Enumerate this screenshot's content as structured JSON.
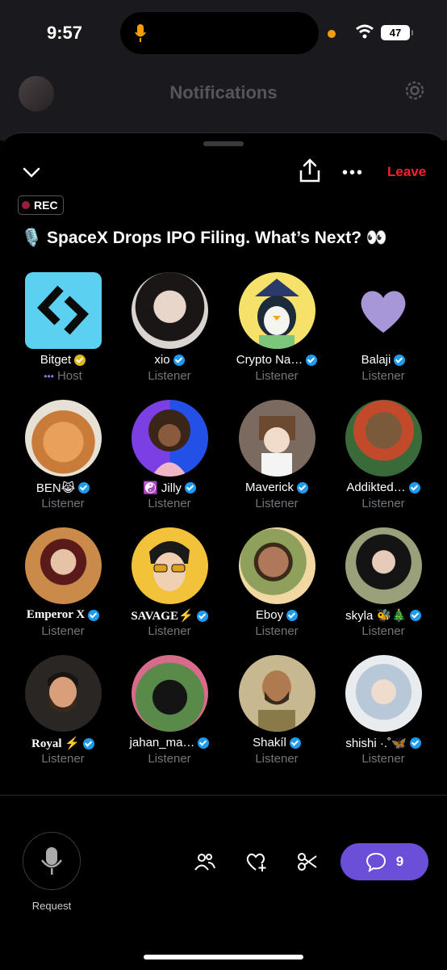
{
  "status_bar": {
    "time": "9:57",
    "battery": "47"
  },
  "header": {
    "title": "Notifications"
  },
  "space": {
    "leave_label": "Leave",
    "rec_label": "REC",
    "title": "🎙️ SpaceX Drops IPO Filing. What’s Next? 👀"
  },
  "participants": [
    {
      "name": "Bitget",
      "role": "Host",
      "badge": "gold",
      "role_prefix": "•••"
    },
    {
      "name": "xio",
      "role": "Listener",
      "badge": "blue"
    },
    {
      "name": "Crypto Na…",
      "role": "Listener",
      "badge": "blue"
    },
    {
      "name": "Balaji",
      "role": "Listener",
      "badge": "blue"
    },
    {
      "name": "BEN😹",
      "role": "Listener",
      "badge": "blue"
    },
    {
      "name": "☯️ Jilly",
      "role": "Listener",
      "badge": "blue"
    },
    {
      "name": "Maverick",
      "role": "Listener",
      "badge": "blue"
    },
    {
      "name": "Addikted…",
      "role": "Listener",
      "badge": "blue"
    },
    {
      "name": "Emperor X",
      "role": "Listener",
      "badge": "blue"
    },
    {
      "name": "SAVAGE⚡",
      "role": "Listener",
      "badge": "blue"
    },
    {
      "name": "Eboy",
      "role": "Listener",
      "badge": "blue"
    },
    {
      "name": "skyla 🐝🎄",
      "role": "Listener",
      "badge": "blue"
    },
    {
      "name": "Royal ⚡",
      "role": "Listener",
      "badge": "blue"
    },
    {
      "name": "jahan_ma…",
      "role": "Listener",
      "badge": "blue"
    },
    {
      "name": "Shakíl",
      "role": "Listener",
      "badge": "blue"
    },
    {
      "name": "shishi ·.˚🦋",
      "role": "Listener",
      "badge": "blue"
    }
  ],
  "bottom_bar": {
    "request_label": "Request",
    "chat_count": "9"
  },
  "colors": {
    "accent": "#6b4fd8",
    "leave": "#f4212e",
    "verified": "#1d9bf0",
    "muted": "#71767b"
  }
}
